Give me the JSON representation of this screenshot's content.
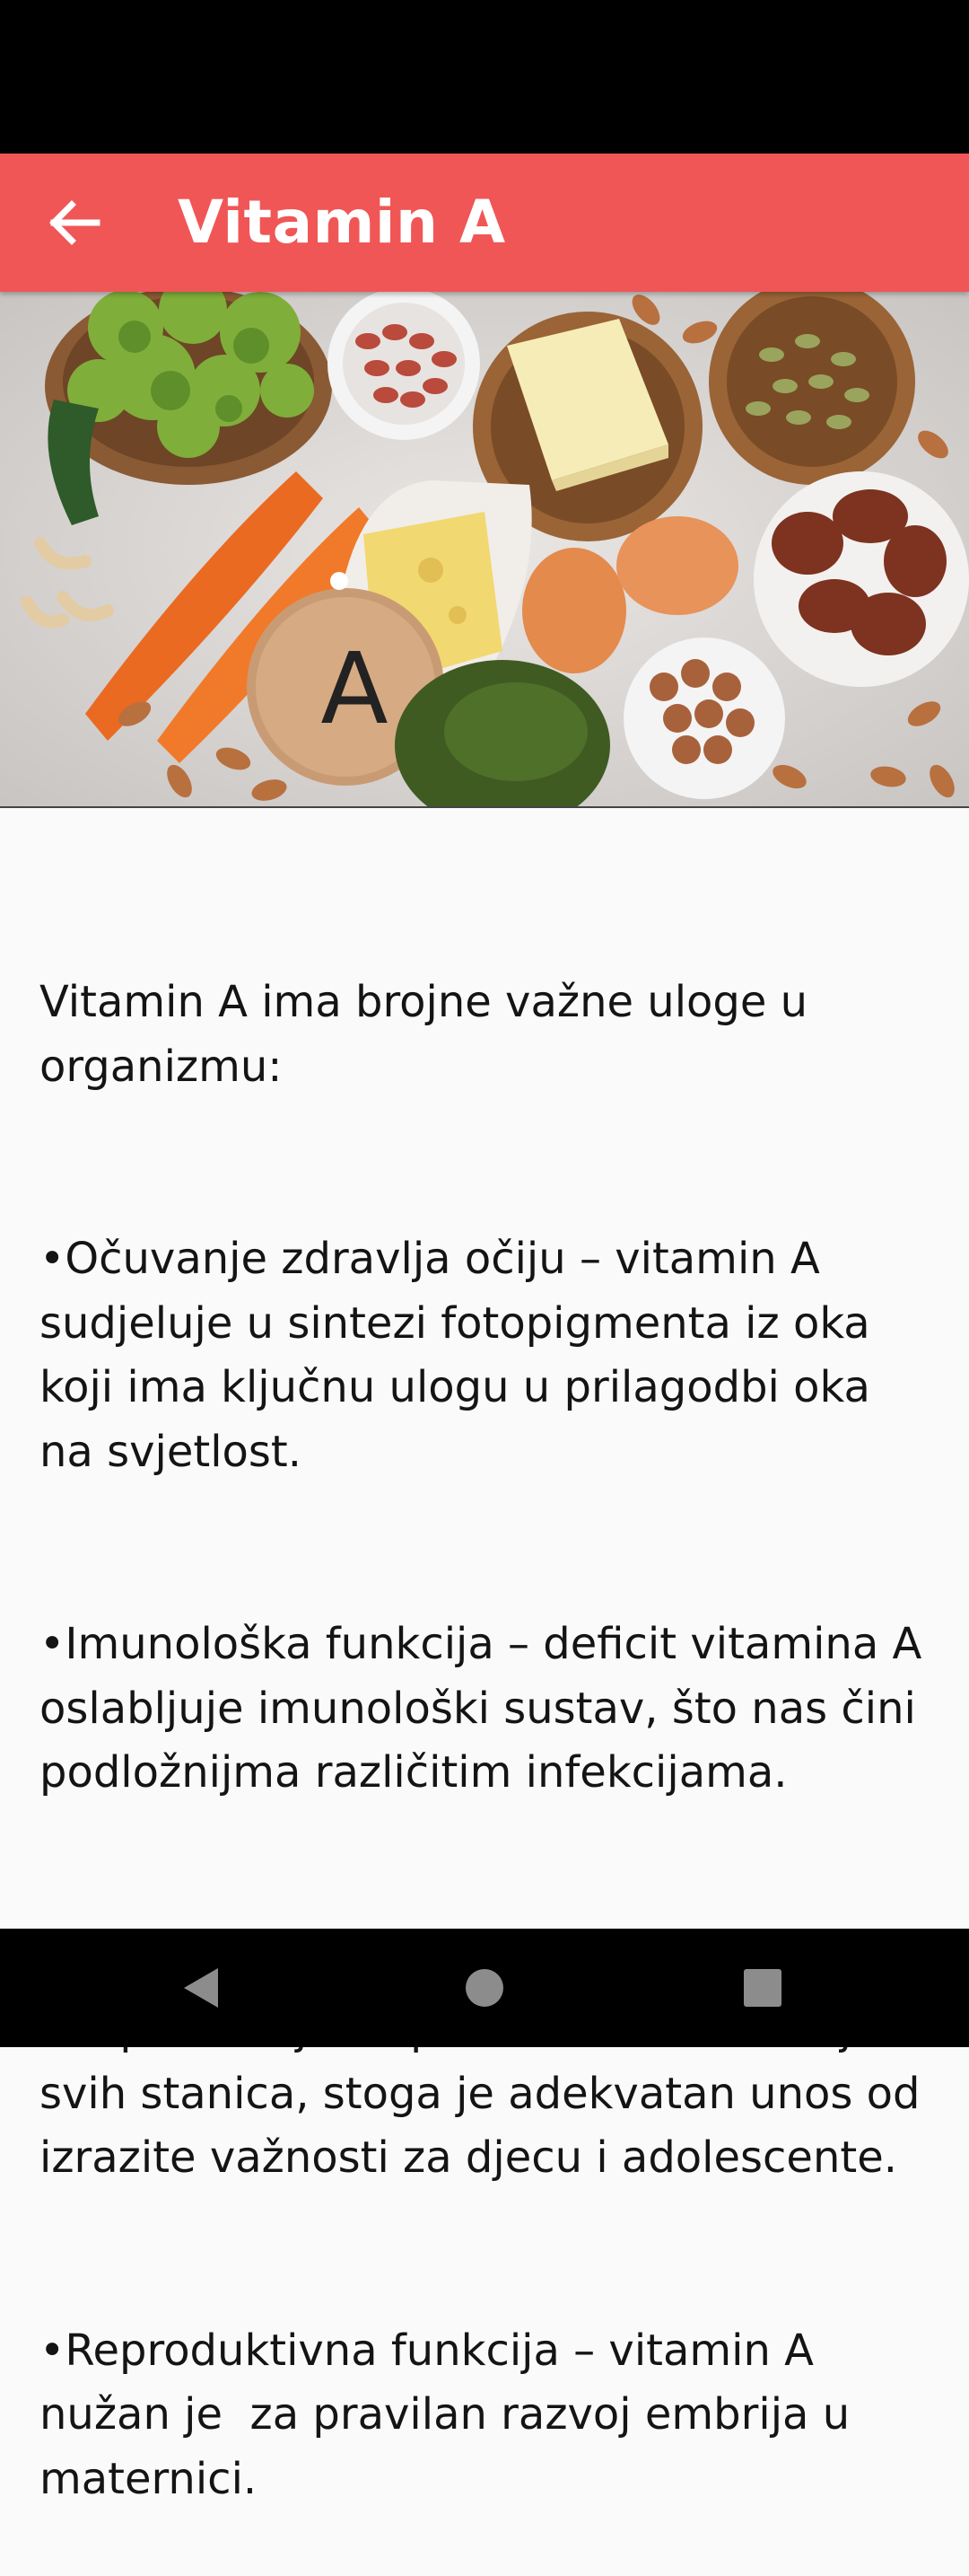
{
  "app_bar": {
    "title": "Vitamin A",
    "color": "#f05656",
    "back_icon": "arrow-back-icon"
  },
  "hero_image": {
    "tag_letter": "A"
  },
  "content": {
    "intro": "Vitamin A ima brojne važne uloge u organizmu:",
    "items": [
      "•Očuvanje zdravlja očiju – vitamin A sudjeluje u sintezi fotopigmenta iz oka koji ima ključnu ulogu u prilagodbi oka na svjetlost.",
      "•Imunološka funkcija – deficit vitamina A oslabljuje imunološki sustav, što nas čini podložnijma različitim infekcijama.",
      "•Podržava razvoj stanica – vitamin A neophodan je za pravilan rast i razvoj svih stanica, stoga je adekvatan unos od izrazite važnosti za djecu i adolescente.",
      "•Reproduktivna funkcija – vitamin A nužan je  za pravilan razvoj embrija u maternici."
    ]
  },
  "nav_bar": {
    "icons": [
      "back-triangle-icon",
      "home-circle-icon",
      "recents-square-icon"
    ]
  }
}
